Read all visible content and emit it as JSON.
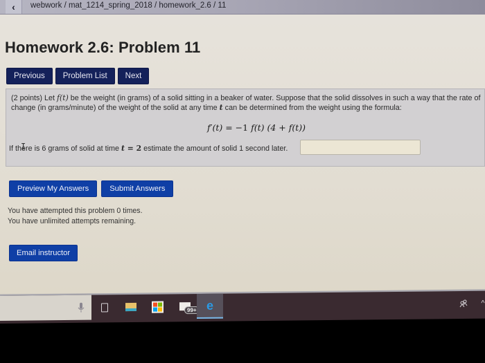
{
  "browser": {
    "back_icon": "‹",
    "breadcrumb": "webwork / mat_1214_spring_2018 / homework_2.6 / 11"
  },
  "page": {
    "title": "Homework 2.6: Problem 11"
  },
  "nav": {
    "previous": "Previous",
    "problem_list": "Problem List",
    "next": "Next"
  },
  "problem": {
    "points": "(2 points) Let ",
    "f_of_t": "f(t)",
    "line1_rest": " be the weight (in grams) of a solid sitting in a beaker of water. Suppose that the solid dissolves in such a way that the rate of change (in grams/minute) of the weight of the solid at any time ",
    "t": "t",
    "line2_rest": " can be determined from the weight using the formula:",
    "formula": {
      "lhs": "f′(t)",
      "eq": " = −1 ",
      "rhs": "f(t) (4 + f(t))"
    },
    "question_pre": "If there is 6 grams of solid at time ",
    "question_var": "t",
    "question_eq": " = 2",
    "question_post": " estimate the amount of solid 1 second later.",
    "answer_value": "",
    "answer_placeholder": ""
  },
  "actions": {
    "preview": "Preview My Answers",
    "submit": "Submit Answers"
  },
  "status": {
    "attempted": "You have attempted this problem 0 times.",
    "remaining": "You have unlimited attempts remaining."
  },
  "email": {
    "label": "Email instructor"
  },
  "taskbar": {
    "icons": [
      "microphone-icon",
      "task-view-icon",
      "file-explorer-icon",
      "store-icon",
      "mail-icon",
      "edge-icon",
      "people-icon",
      "chevron-up-icon"
    ],
    "mail_badge": "99+",
    "edge_glyph": "e",
    "mic_glyph": "🎙",
    "people_glyph": "ᴿᴬ",
    "chevron_glyph": "^"
  },
  "colors": {
    "nav_button": "#14215a",
    "action_button": "#0f3fa6",
    "problem_bg": "#d2d0d2",
    "answer_bg": "#ece6d4"
  }
}
